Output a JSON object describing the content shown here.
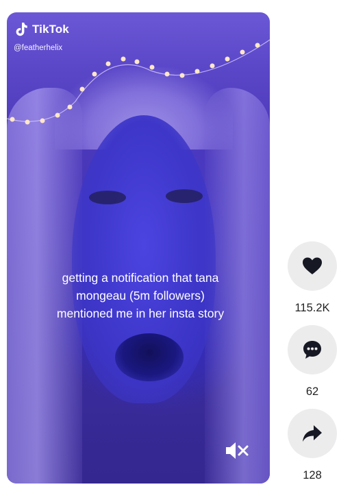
{
  "video": {
    "brand": "TikTok",
    "handle": "@featherhelix",
    "caption": "getting a notification that tana mongeau (5m followers) mentioned me in her insta story",
    "muted_icon": "speaker-muted-icon"
  },
  "actions": {
    "like": {
      "icon": "heart-icon",
      "count": "115.2K"
    },
    "comment": {
      "icon": "comment-bubble-icon",
      "count": "62"
    },
    "share": {
      "icon": "share-arrow-icon",
      "count": "128"
    }
  },
  "colors": {
    "action_bg": "#ececec",
    "icon": "#161823",
    "caption_text": "#ffffff"
  }
}
